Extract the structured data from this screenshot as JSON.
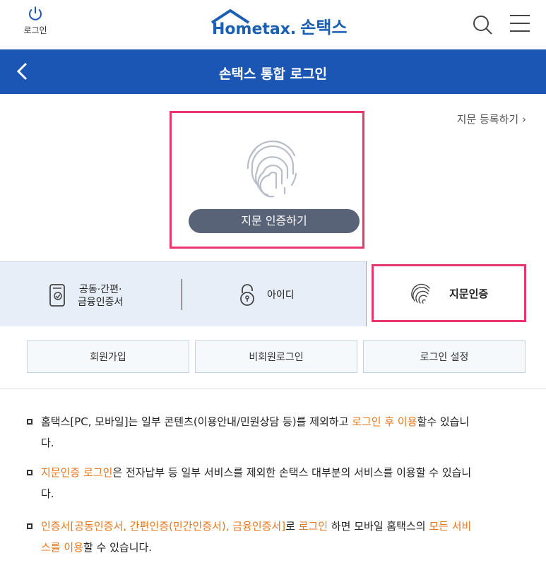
{
  "header": {
    "login_label": "로그인",
    "logo_text": "Hometax.",
    "logo_kr": "손택스"
  },
  "nav": {
    "title": "손택스 통합 로그인"
  },
  "fingerprint": {
    "register_link": "지문 등록하기",
    "auth_button": "지문 인증하기"
  },
  "tabs": {
    "cert_line1": "공동·간편·",
    "cert_line2": "금융인증서",
    "id_label": "아이디",
    "fp_label": "지문인증"
  },
  "buttons": {
    "join": "회원가입",
    "guest_login": "비회원로그인",
    "login_settings": "로그인 설정"
  },
  "notices": {
    "n1_a": "홈택스[PC, 모바일]는 일부 콘텐츠(이용안내/민원상담 등)를 제외하고 ",
    "n1_hl": "로그인 후 이용",
    "n1_b": "할수 있습니",
    "n1_c": "다.",
    "n2_hl": "지문인증 로그인",
    "n2_a": "은 전자납부 등 일부 서비스를 제외한 손택스 대부분의 서비스를 이용할 수 있습니",
    "n2_b": "다.",
    "n3_hl1": "인증서[공동인증서, 간편인증(민간인증서), 금융인증서]",
    "n3_a": "로 ",
    "n3_hl2": "로그인",
    "n3_b": " 하면 모바일 홈택스의 ",
    "n3_hl3": "모든 서비",
    "n3_hl4": "스를 이용",
    "n3_c": "할 수 있습니다."
  },
  "colors": {
    "brand": "#1c56b4",
    "highlight": "#e8356b",
    "accent_text": "#e8761b"
  }
}
